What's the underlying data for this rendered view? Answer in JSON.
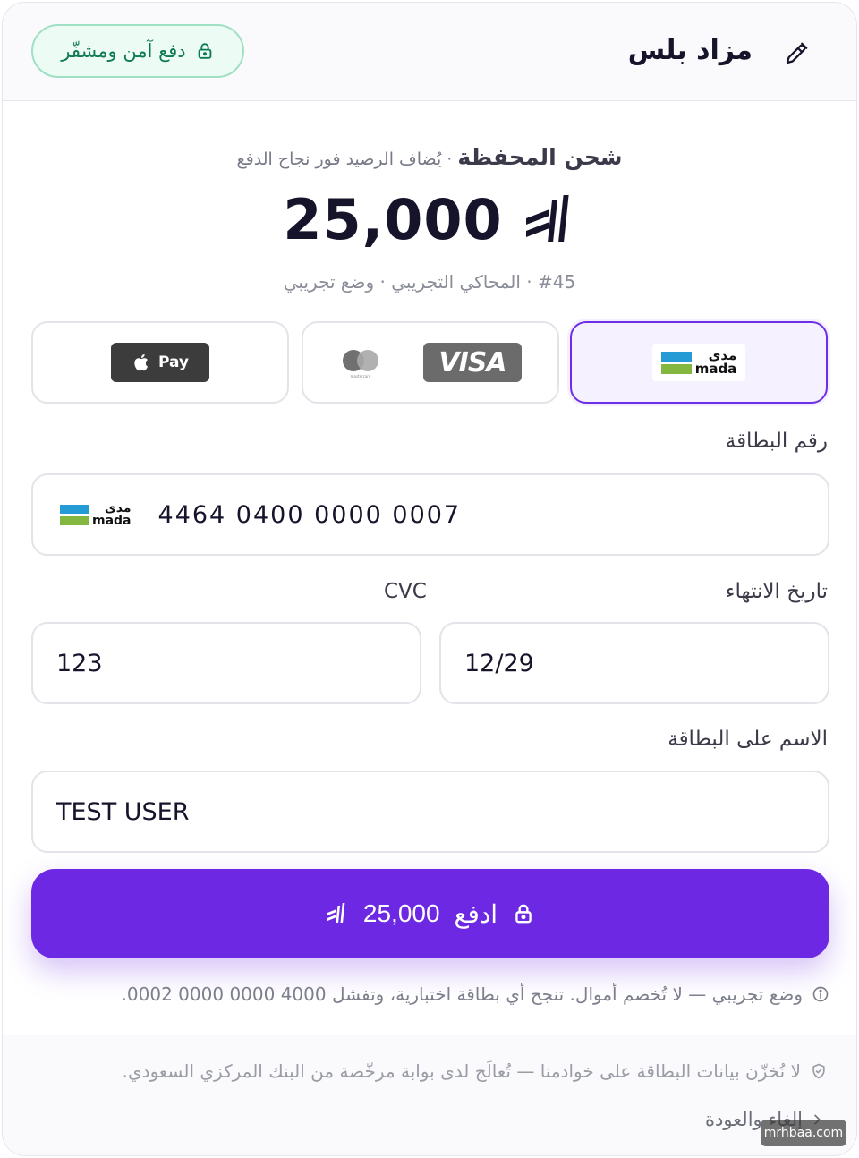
{
  "header": {
    "brand": "مزاد بلس",
    "secure_badge": "دفع آمن ومشفّر"
  },
  "summary": {
    "title": "شحن المحفظة",
    "subtitle": " · يُضاف الرصيد فور نجاح الدفع",
    "amount": "25,000",
    "currency_icon": "riyal-icon",
    "meta": "#45 · المحاكي التجريبي · وضع تجريبي"
  },
  "methods": {
    "selected": "mada",
    "mada_ar": "مدى",
    "mada_en": "mada",
    "visa": "VISA",
    "mastercard": "mastercard",
    "apple_pay": "Pay"
  },
  "form": {
    "card_label": "رقم البطاقة",
    "card_value": "4464 0400 0000 0007",
    "expiry_label": "تاريخ الانتهاء",
    "expiry_value": "12/29",
    "cvc_label": "CVC",
    "cvc_value": "123",
    "name_label": "الاسم على البطاقة",
    "name_value": "TEST USER"
  },
  "pay_button": {
    "label": "ادفع",
    "amount": "25,000"
  },
  "test_note": "وضع تجريبي — لا تُخصم أموال. تنجح أي بطاقة اختبارية، وتفشل 4000 0000 0000 0002.",
  "footer": {
    "security_note": "لا نُخزّن بيانات البطاقة على خوادمنا — تُعالَج لدى بوابة مرخّصة من البنك المركزي السعودي.",
    "cancel_label": "إلغاء والعودة"
  },
  "watermark": "mrhbaa.com",
  "colors": {
    "accent": "#6d28e4",
    "secure_green": "#0e7a53",
    "mada_blue": "#259bd6",
    "mada_green": "#84b740"
  }
}
